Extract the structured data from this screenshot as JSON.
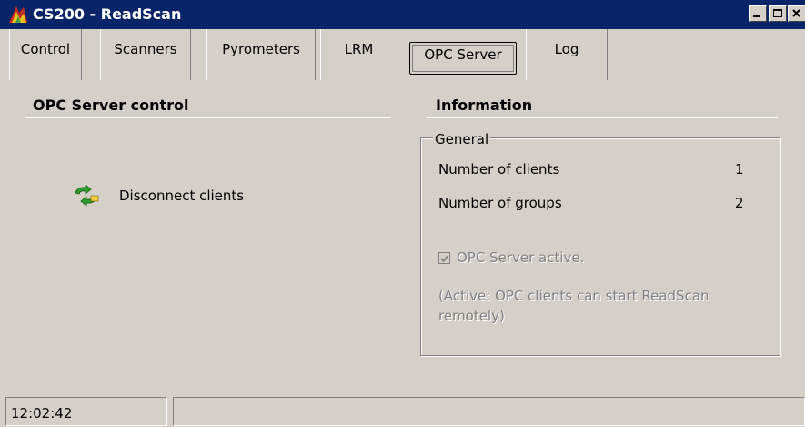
{
  "window": {
    "title": "CS200 - ReadScan"
  },
  "tabs": [
    {
      "label": "Control",
      "selected": false
    },
    {
      "label": "Scanners",
      "selected": false
    },
    {
      "label": "Pyrometers",
      "selected": false
    },
    {
      "label": "LRM",
      "selected": false
    },
    {
      "label": "OPC Server",
      "selected": true
    },
    {
      "label": "Log",
      "selected": false
    }
  ],
  "opc_control": {
    "title": "OPC Server control",
    "disconnect_label": "Disconnect clients"
  },
  "information": {
    "title": "Information",
    "group_label": "General",
    "rows": [
      {
        "label": "Number of clients",
        "value": "1"
      },
      {
        "label": "Number of groups",
        "value": "2"
      }
    ],
    "checkbox_label": "OPC Server active.",
    "checkbox_checked": true,
    "note": "(Active: OPC clients can start ReadScan remotely)"
  },
  "statusbar": {
    "time": "12:02:42"
  },
  "colors": {
    "titlebar": "#0a246a",
    "face": "#d4d0c8",
    "disabled_text": "#808080"
  }
}
